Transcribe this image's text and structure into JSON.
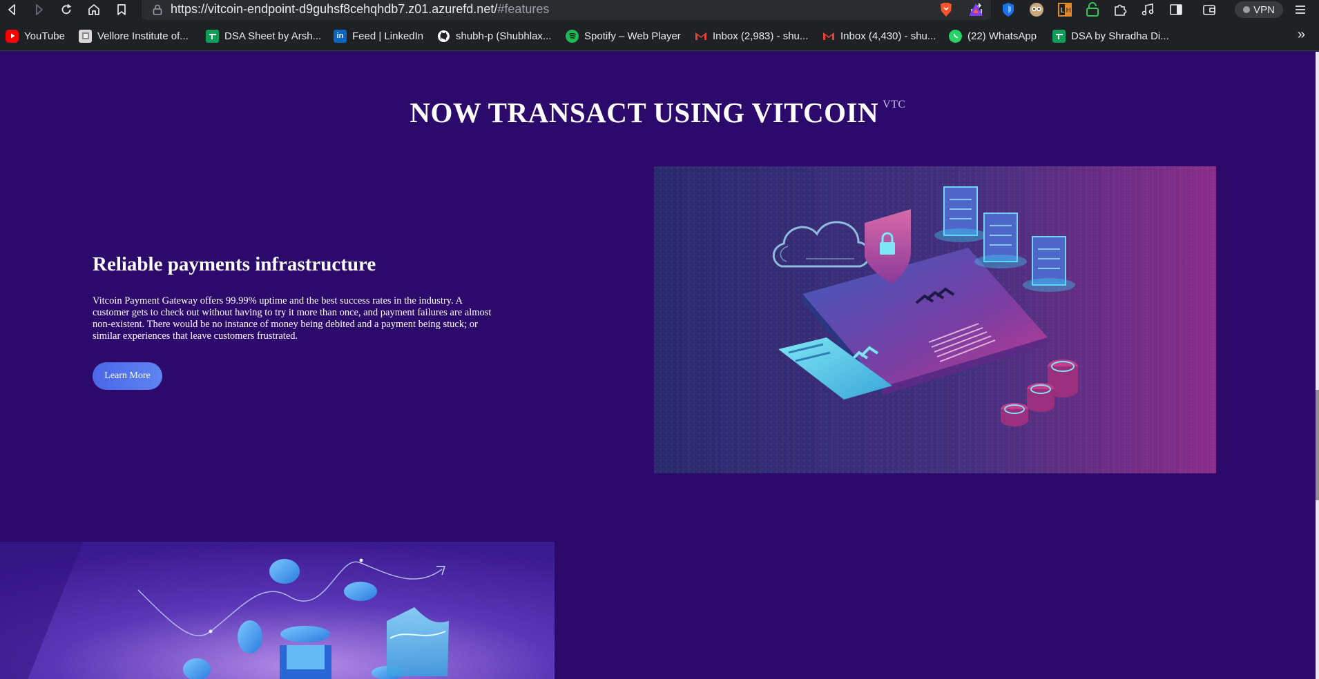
{
  "browser": {
    "url_main": "https://vitcoin-endpoint-d9guhsf8cehqhdb7.z01.azurefd.net/",
    "url_hash": "#features",
    "vpn_label": "VPN",
    "bookmarks": [
      {
        "label": "YouTube",
        "icon": "youtube-icon",
        "color": "#ff0000"
      },
      {
        "label": "Vellore Institute of...",
        "icon": "vit-icon",
        "color": "#d9d9d9"
      },
      {
        "label": "DSA Sheet by Arsh...",
        "icon": "sheets-icon",
        "color": "#0f9d58"
      },
      {
        "label": "Feed | LinkedIn",
        "icon": "linkedin-icon",
        "color": "#0a66c2"
      },
      {
        "label": "shubh-p (Shubhlax...",
        "icon": "github-icon",
        "color": "#ffffff"
      },
      {
        "label": "Spotify – Web Player",
        "icon": "spotify-icon",
        "color": "#1db954"
      },
      {
        "label": "Inbox (2,983) - shu...",
        "icon": "gmail-icon",
        "color": "#ea4335"
      },
      {
        "label": "Inbox (4,430) - shu...",
        "icon": "gmail-icon",
        "color": "#ea4335"
      },
      {
        "label": "(22) WhatsApp",
        "icon": "whatsapp-icon",
        "color": "#25d366"
      },
      {
        "label": "DSA by Shradha Di...",
        "icon": "sheets-icon",
        "color": "#0f9d58"
      }
    ],
    "more_label": "»"
  },
  "page": {
    "hero_title": "NOW TRANSACT USING VITCOIN",
    "hero_sup": "VTC",
    "feature_title": "Reliable payments infrastructure",
    "feature_body": "Vitcoin Payment Gateway offers 99.99% uptime and the best success rates in the industry. A customer gets to check out without having to try it more than once, and payment failures are almost non-existent. There would be no instance of money being debited and a payment being stuck; or similar experiences that leave customers frustrated.",
    "learn_more_label": "Learn More"
  },
  "colors": {
    "page_bg": "#2c0a6c",
    "button": "#4a67e8",
    "chrome_bg": "#202124"
  }
}
